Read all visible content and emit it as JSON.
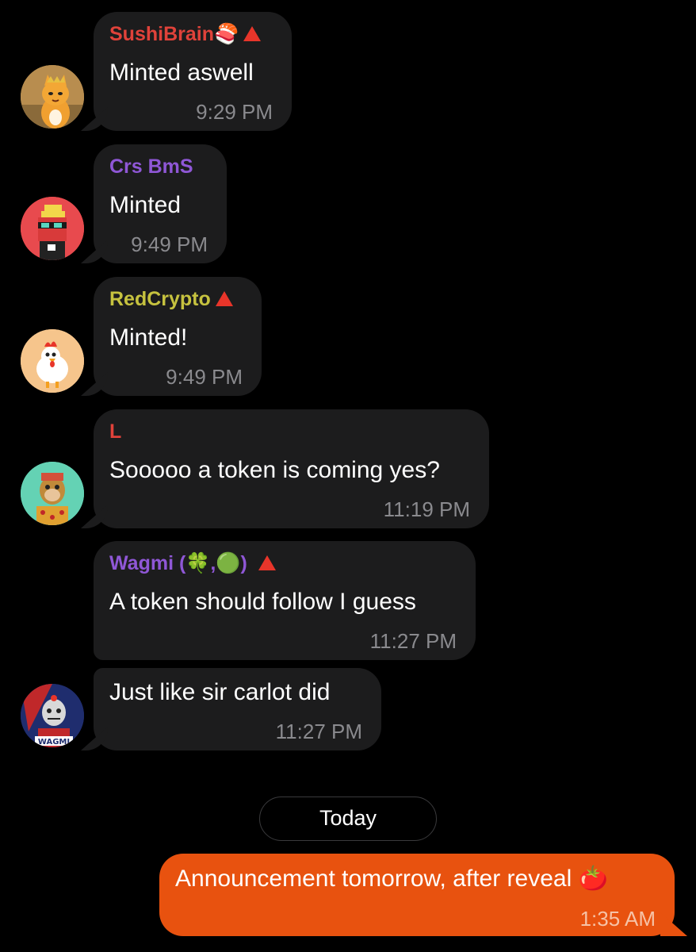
{
  "messages": [
    {
      "sender": "SushiBrain",
      "sender_badge": "🍣",
      "sender_color": "#e0423a",
      "text": "Minted aswell",
      "time": "9:29 PM",
      "avatar": "cat-avatar"
    },
    {
      "sender": "Crs BmS",
      "sender_color": "#8f57d6",
      "text": "Minted",
      "time": "9:49 PM",
      "avatar": "pixel-punk-avatar"
    },
    {
      "sender": "RedCrypto",
      "sender_color": "#c6c23f",
      "text": "Minted!",
      "time": "9:49 PM",
      "avatar": "chicken-avatar"
    },
    {
      "sender": "L",
      "sender_color": "#e0423a",
      "text": "Sooooo a token is coming yes?",
      "time": "11:19 PM",
      "avatar": "ape-avatar"
    },
    {
      "sender": "Wagmi (",
      "sender_suffix": ")",
      "sender_emojis": "🍀,🟢",
      "sender_color": "#8f57d6",
      "text": "A token should follow I guess",
      "time": "11:27 PM"
    },
    {
      "text": "Just like sir carlot did",
      "time": "11:27 PM",
      "avatar": "clown-avatar",
      "avatar_label": "WAGMI"
    }
  ],
  "date_separator": "Today",
  "outgoing": {
    "text": "Announcement tomorrow, after reveal",
    "emoji": "🍅",
    "time": "1:35 AM",
    "color": "#e8520f"
  }
}
